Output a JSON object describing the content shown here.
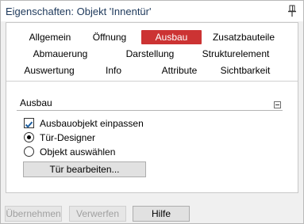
{
  "window": {
    "title": "Eigenschaften: Objekt 'Innentür'"
  },
  "tabs": [
    {
      "label": "Allgemein"
    },
    {
      "label": "Öffnung"
    },
    {
      "label": "Ausbau",
      "active": true
    },
    {
      "label": "Zusatzbauteile"
    },
    {
      "label": "Abmauerung"
    },
    {
      "label": "Darstellung"
    },
    {
      "label": "Strukturelement"
    },
    {
      "label": "Auswertung"
    },
    {
      "label": "Info"
    },
    {
      "label": "Attribute"
    },
    {
      "label": "Sichtbarkeit"
    }
  ],
  "group": {
    "title": "Ausbau",
    "checkbox_label": "Ausbauobjekt einpassen",
    "checkbox_checked": true,
    "radio_1_label": "Tür-Designer",
    "radio_1_checked": true,
    "radio_2_label": "Objekt auswählen",
    "radio_2_checked": false,
    "edit_button": "Tür bearbeiten..."
  },
  "footer": {
    "apply_button": "Übernehmen",
    "discard_button": "Verwerfen",
    "help_button": "Hilfe"
  },
  "colors": {
    "active_tab": "#cc3333",
    "checkmark": "#1e5fa0"
  }
}
